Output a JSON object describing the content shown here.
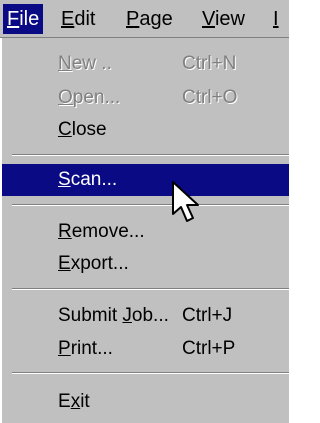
{
  "menubar": {
    "file": {
      "u": "F",
      "rest": "ile"
    },
    "edit": {
      "u": "E",
      "rest": "dit"
    },
    "page": {
      "u": "P",
      "rest": "age"
    },
    "view": {
      "u": "V",
      "rest": "iew"
    },
    "truncated": "I"
  },
  "menu": {
    "new": {
      "u": "N",
      "rest": "ew ..",
      "shortcut": "Ctrl+N"
    },
    "open": {
      "u": "O",
      "rest": "pen...",
      "shortcut": "Ctrl+O"
    },
    "close": {
      "u": "C",
      "rest": "lose"
    },
    "scan": {
      "u": "S",
      "rest": "can..."
    },
    "remove": {
      "u": "R",
      "rest": "emove..."
    },
    "export": {
      "u": "E",
      "rest": "xport..."
    },
    "submit_job": {
      "pre": "Submit ",
      "u": "J",
      "rest": "ob...",
      "shortcut": "Ctrl+J"
    },
    "print": {
      "u": "P",
      "rest": "rint...",
      "shortcut": "Ctrl+P"
    },
    "exit": {
      "pre": "E",
      "u": "x",
      "rest": "it"
    }
  },
  "colors": {
    "menu_bg": "#c0c0c0",
    "highlight": "#0a0a84",
    "disabled_text": "#808080"
  },
  "icons": {
    "cursor": "arrow-pointer"
  }
}
